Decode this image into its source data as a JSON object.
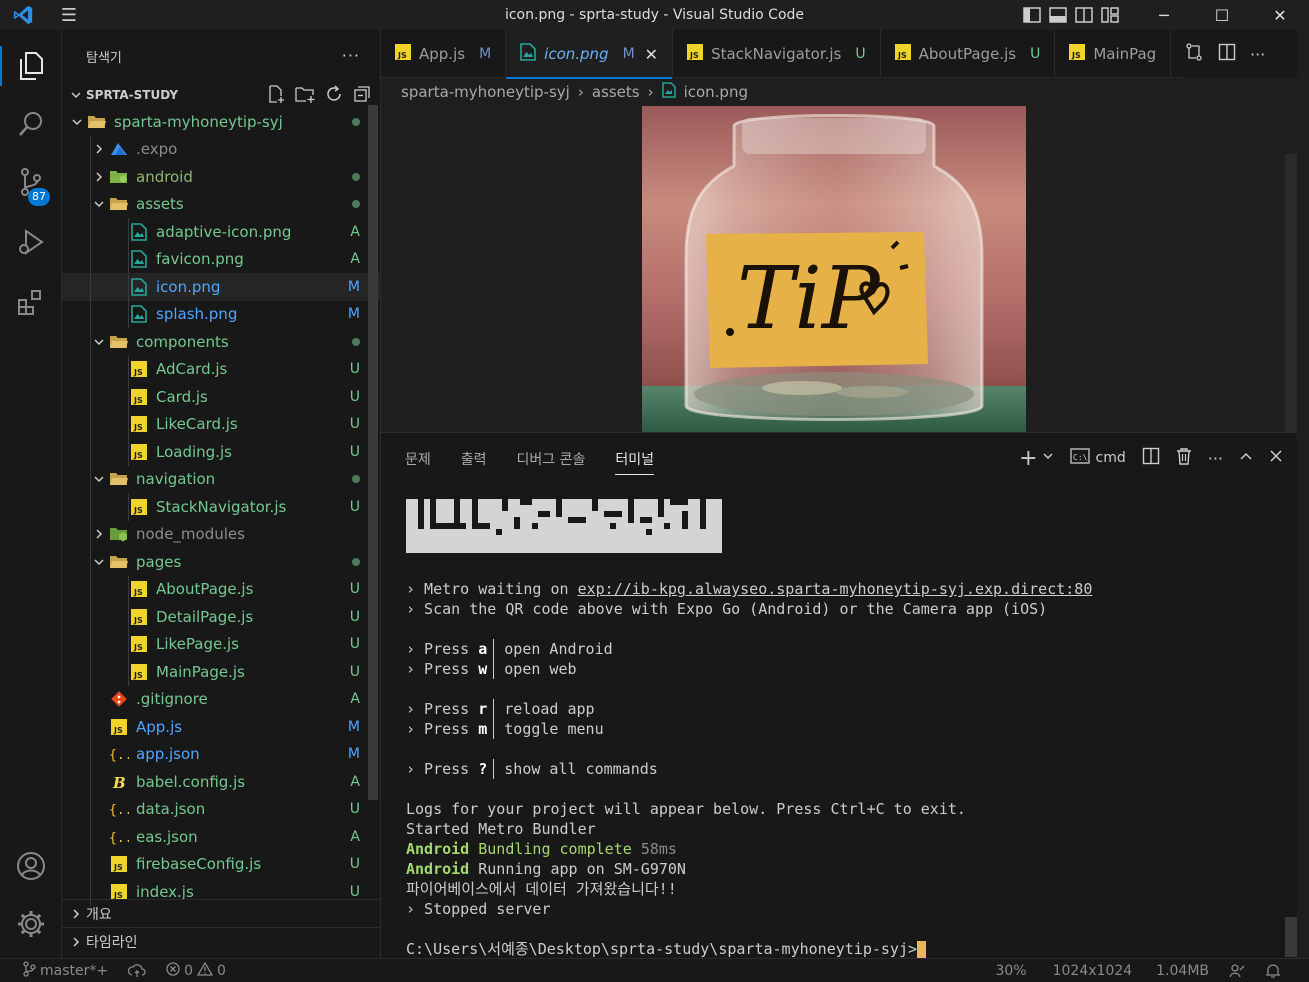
{
  "window": {
    "title": "icon.png - sprta-study - Visual Studio Code",
    "minimize": "─",
    "maximize": "☐",
    "close": "✕"
  },
  "activity": {
    "scm_badge": "87"
  },
  "sidebar": {
    "header": "탐색기",
    "more": "···",
    "section": "SPRTA-STUDY",
    "tree": [
      {
        "label": "sparta-myhoneytip-syj",
        "depth": 1,
        "type": "folder-open",
        "status": "dot",
        "color": "#73c991"
      },
      {
        "label": ".expo",
        "depth": 2,
        "type": "folder",
        "status": "",
        "color": "#8c8c8c"
      },
      {
        "label": "android",
        "depth": 2,
        "type": "folder-android",
        "status": "dot",
        "color": "#8fb573"
      },
      {
        "label": "assets",
        "depth": 2,
        "type": "folder-open",
        "status": "dot",
        "color": "#73c991"
      },
      {
        "label": "adaptive-icon.png",
        "depth": 3,
        "type": "image",
        "status": "A",
        "color": "#73c991"
      },
      {
        "label": "favicon.png",
        "depth": 3,
        "type": "image",
        "status": "A",
        "color": "#73c991"
      },
      {
        "label": "icon.png",
        "depth": 3,
        "type": "image",
        "status": "M",
        "color": "#4fa6ff",
        "selected": true
      },
      {
        "label": "splash.png",
        "depth": 3,
        "type": "image",
        "status": "M",
        "color": "#4fa6ff"
      },
      {
        "label": "components",
        "depth": 2,
        "type": "folder-open",
        "status": "dot",
        "color": "#73c991"
      },
      {
        "label": "AdCard.js",
        "depth": 3,
        "type": "js",
        "status": "U",
        "color": "#73c991"
      },
      {
        "label": "Card.js",
        "depth": 3,
        "type": "js",
        "status": "U",
        "color": "#73c991"
      },
      {
        "label": "LikeCard.js",
        "depth": 3,
        "type": "js",
        "status": "U",
        "color": "#73c991"
      },
      {
        "label": "Loading.js",
        "depth": 3,
        "type": "js",
        "status": "U",
        "color": "#73c991"
      },
      {
        "label": "navigation",
        "depth": 2,
        "type": "folder-open",
        "status": "dot",
        "color": "#73c991"
      },
      {
        "label": "StackNavigator.js",
        "depth": 3,
        "type": "js",
        "status": "U",
        "color": "#73c991"
      },
      {
        "label": "node_modules",
        "depth": 2,
        "type": "folder-node",
        "status": "",
        "color": "#8c8c8c"
      },
      {
        "label": "pages",
        "depth": 2,
        "type": "folder-open",
        "status": "dot",
        "color": "#73c991"
      },
      {
        "label": "AboutPage.js",
        "depth": 3,
        "type": "js",
        "status": "U",
        "color": "#73c991"
      },
      {
        "label": "DetailPage.js",
        "depth": 3,
        "type": "js",
        "status": "U",
        "color": "#73c991"
      },
      {
        "label": "LikePage.js",
        "depth": 3,
        "type": "js",
        "status": "U",
        "color": "#73c991"
      },
      {
        "label": "MainPage.js",
        "depth": 3,
        "type": "js",
        "status": "U",
        "color": "#73c991"
      },
      {
        "label": ".gitignore",
        "depth": 2,
        "type": "git",
        "status": "A",
        "color": "#73c991"
      },
      {
        "label": "App.js",
        "depth": 2,
        "type": "js",
        "status": "M",
        "color": "#4fa6ff"
      },
      {
        "label": "app.json",
        "depth": 2,
        "type": "json",
        "status": "M",
        "color": "#4fa6ff"
      },
      {
        "label": "babel.config.js",
        "depth": 2,
        "type": "babel",
        "status": "A",
        "color": "#73c991"
      },
      {
        "label": "data.json",
        "depth": 2,
        "type": "json",
        "status": "U",
        "color": "#73c991"
      },
      {
        "label": "eas.json",
        "depth": 2,
        "type": "json",
        "status": "A",
        "color": "#73c991"
      },
      {
        "label": "firebaseConfig.js",
        "depth": 2,
        "type": "js",
        "status": "U",
        "color": "#73c991"
      },
      {
        "label": "index.js",
        "depth": 2,
        "type": "js",
        "status": "U",
        "color": "#73c991"
      }
    ],
    "outline": "개요",
    "timeline": "타임라인"
  },
  "tabs": [
    {
      "label": "App.js",
      "status": "M",
      "type": "js"
    },
    {
      "label": "icon.png",
      "status": "M",
      "type": "image",
      "active": true
    },
    {
      "label": "StackNavigator.js",
      "status": "U",
      "type": "js"
    },
    {
      "label": "AboutPage.js",
      "status": "U",
      "type": "js"
    },
    {
      "label": "MainPag",
      "status": "",
      "type": "js"
    }
  ],
  "breadcrumb": [
    "sparta-myhoneytip-syj",
    "assets",
    "icon.png"
  ],
  "panel": {
    "tabs": [
      "문제",
      "출력",
      "디버그 콘솔",
      "터미널"
    ],
    "active_tab": "터미널",
    "shell": "cmd"
  },
  "terminal": {
    "metro_prefix": "› Metro waiting on ",
    "metro_url": "exp://ib-kpg.alwayseo.sparta-myhoneytip-syj.exp.direct:80",
    "scan": "› Scan the QR code above with Expo Go (Android) or the Camera app (iOS)",
    "commands": [
      [
        {
          "key": "a",
          "desc": "open Android"
        },
        {
          "key": "w",
          "desc": "open web"
        }
      ],
      [
        {
          "key": "r",
          "desc": "reload app"
        },
        {
          "key": "m",
          "desc": "toggle menu"
        }
      ],
      [
        {
          "key": "?",
          "desc": "show all commands"
        }
      ]
    ],
    "press": "› Press ",
    "logs": "Logs for your project will appear below. Press Ctrl+C to exit.",
    "started": "Started Metro Bundler",
    "android": "Android",
    "bundling": " Bundling complete ",
    "bundle_time": "58ms",
    "running": " Running app on SM-G970N",
    "firebase": "파이어베이스에서 데이터 가져왔습니다!!",
    "stopped": "› Stopped server",
    "prompt": "C:\\Users\\서예종\\Desktop\\sprta-study\\sparta-myhoneytip-syj>"
  },
  "statusbar": {
    "branch": "master*+",
    "errors": "0",
    "warnings": "0",
    "zoom": "30%",
    "dimensions": "1024x1024",
    "size": "1.04MB"
  },
  "image": {
    "text": "TiP"
  }
}
